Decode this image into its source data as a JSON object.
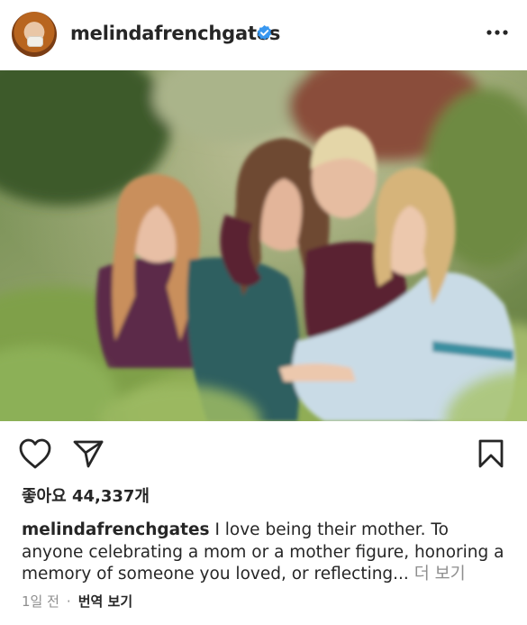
{
  "post": {
    "username": "melindafrenchgates",
    "likes_label": "좋아요",
    "likes_count": "44,337개",
    "caption_username": "melindafrenchgates",
    "caption_text": " I love being their mother. To anyone celebrating a mom or a mother figure, honoring a memory of someone you loved, or reflecting...",
    "more_label": " 더 보기",
    "time_ago": "1일 전",
    "separator": "·",
    "translate_label": "번역 보기"
  },
  "icons": {
    "verified": "verified-badge-icon",
    "more": "more-options-icon",
    "like": "heart-icon",
    "share": "paper-plane-icon",
    "save": "bookmark-icon"
  },
  "colors": {
    "text": "#262626",
    "muted": "#8e8e8e",
    "verified": "#3897f0"
  }
}
